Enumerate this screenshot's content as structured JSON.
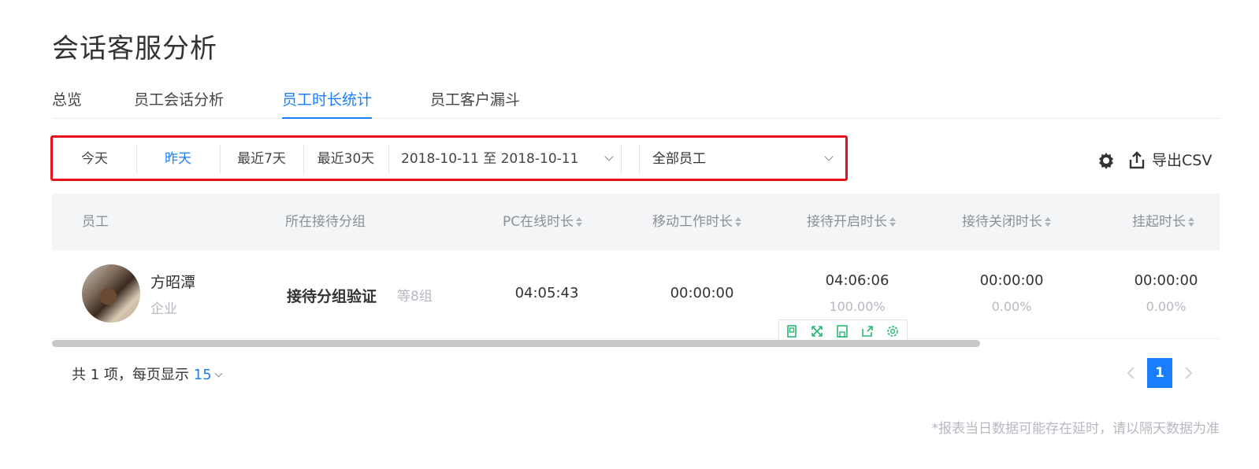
{
  "page": {
    "title": "会话客服分析"
  },
  "tabs": [
    {
      "label": "总览"
    },
    {
      "label": "员工会话分析"
    },
    {
      "label": "员工时长统计"
    },
    {
      "label": "员工客户漏斗"
    }
  ],
  "active_tab": "员工时长统计",
  "filters": {
    "quick_ranges": [
      "今天",
      "昨天",
      "最近7天",
      "最近30天"
    ],
    "active_range": "昨天",
    "date_range": "2018-10-11 至 2018-10-11",
    "staff_select": "全部员工"
  },
  "actions": {
    "export_label": "导出CSV",
    "settings_icon": "gear-icon",
    "export_icon": "upload-icon"
  },
  "table": {
    "columns": [
      "员工",
      "所在接待分组",
      "PC在线时长",
      "移动工作时长",
      "接待开启时长",
      "接待关闭时长",
      "挂起时长"
    ],
    "rows": [
      {
        "name": "方昭潭",
        "type": "企业",
        "group": "接待分组验证",
        "group_extra": "等8组",
        "pc_online": "04:05:43",
        "mobile_work": "00:00:00",
        "reception_open": "04:06:06",
        "reception_open_pct": "100.00%",
        "reception_closed": "00:00:00",
        "reception_closed_pct": "0.00%",
        "suspended": "00:00:00",
        "suspended_pct": "0.00%"
      }
    ]
  },
  "pagination": {
    "summary": "共 1 项，每页显示",
    "page_size": "15",
    "current_page": "1"
  },
  "notice": "*报表当日数据可能存在延时，请以隔天数据为准",
  "colors": {
    "accent": "#1a7dfc",
    "highlight_border": "#e8121d",
    "toolbar_icon": "#2bb673"
  }
}
